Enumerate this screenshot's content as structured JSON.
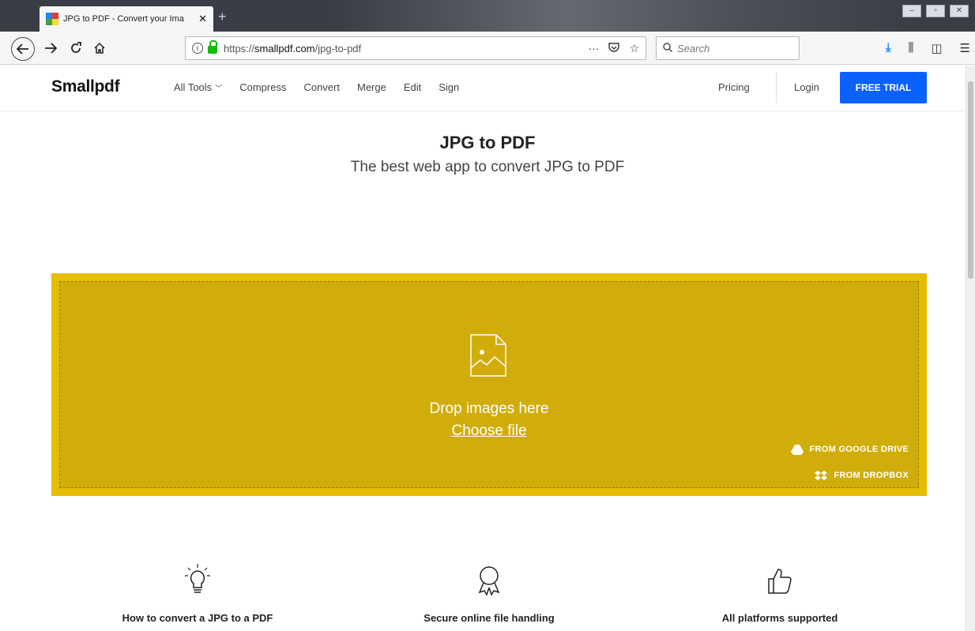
{
  "browser": {
    "tab_title": "JPG to PDF - Convert your Ima",
    "tab_close": "✕",
    "new_tab": "+",
    "window_controls": [
      "–",
      "▫",
      "✕"
    ],
    "url_prefix": "https://",
    "url_host": "smallpdf.com",
    "url_path": "/jpg-to-pdf",
    "page_actions": "···",
    "search_placeholder": "Search",
    "icons": {
      "back": "back-arrow-icon",
      "forward": "forward-arrow-icon",
      "reload": "reload-icon",
      "home": "home-icon"
    }
  },
  "site": {
    "logo": "Smallpdf",
    "nav": [
      "All Tools",
      "Compress",
      "Convert",
      "Merge",
      "Edit",
      "Sign"
    ],
    "pricing": "Pricing",
    "login": "Login",
    "trial": "FREE TRIAL"
  },
  "hero": {
    "title": "JPG to PDF",
    "subtitle": "The best web app to convert JPG to PDF"
  },
  "dropzone": {
    "drop_text": "Drop images here",
    "choose": "Choose file",
    "google_drive": "FROM GOOGLE DRIVE",
    "dropbox": "FROM DROPBOX",
    "color": "#e6bd00"
  },
  "features": [
    {
      "label": "How to convert a JPG to a PDF",
      "icon": "lightbulb-icon"
    },
    {
      "label": "Secure online file handling",
      "icon": "award-ribbon-icon"
    },
    {
      "label": "All platforms supported",
      "icon": "thumbs-up-icon"
    }
  ]
}
